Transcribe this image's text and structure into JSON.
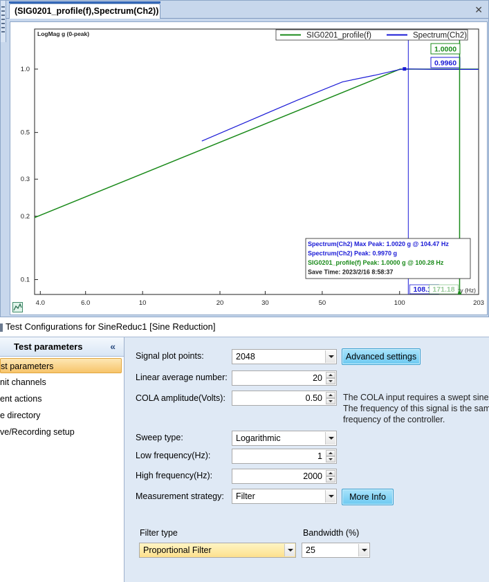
{
  "plot_window": {
    "tab_title": "(SIG0201_profile(f),Spectrum(Ch2))",
    "close_icon": "close-icon"
  },
  "chart_data": {
    "type": "line",
    "ylabel": "LogMag g (0-peak)",
    "xlabel": "Frequency (Hz)",
    "x_scale": "log",
    "y_scale": "log",
    "xlim": [
      3.8,
      203
    ],
    "ylim": [
      0.085,
      1.55
    ],
    "x_ticks": [
      4.0,
      6.0,
      10,
      20,
      30,
      50,
      100,
      203
    ],
    "x_tick_labels": [
      "4.0",
      "6.0",
      "10",
      "20",
      "30",
      "50",
      "100",
      "203"
    ],
    "y_ticks": [
      0.1,
      0.2,
      0.3,
      0.5,
      1.0
    ],
    "y_tick_labels": [
      "0.1",
      "0.2",
      "0.3",
      "0.5",
      "1.0"
    ],
    "legend_placement": "top-right",
    "series": [
      {
        "name": "SIG0201_profile(f)",
        "color": "#1a8a1a",
        "x": [
          3.8,
          100.28,
          203
        ],
        "y": [
          0.197,
          1.0,
          1.0
        ]
      },
      {
        "name": "Spectrum(Ch2)",
        "color": "#1a1ad6",
        "x": [
          17,
          25,
          40,
          60,
          80,
          100,
          104.47,
          140,
          203
        ],
        "y": [
          0.455,
          0.557,
          0.712,
          0.87,
          0.935,
          0.995,
          1.002,
          0.997,
          0.997
        ]
      }
    ],
    "cursors": [
      {
        "color": "#1a1ad6",
        "x": 108.11,
        "label": "108.11",
        "readout": "0.9960"
      },
      {
        "color": "#1a8a1a",
        "x": 171.18,
        "label": "171.18",
        "readout": "1.0000"
      }
    ],
    "info_box": [
      {
        "text": "Spectrum(Ch2) Max Peak: 1.0020 g @ 104.47 Hz",
        "color": "#1a1ad6"
      },
      {
        "text": "Spectrum(Ch2) Peak: 0.9970 g",
        "color": "#1a1ad6"
      },
      {
        "text": "SIG0201_profile(f) Peak: 1.0000 g @ 100.28 Hz",
        "color": "#1a8a1a"
      },
      {
        "text": "Save Time: 2023/2/16 8:58:37",
        "color": "#222222"
      }
    ]
  },
  "config": {
    "title": "Test Configurations for SineReduc1 [Sine Reduction]",
    "left_panel": {
      "header": "Test parameters",
      "collapse_icon": "«",
      "items": [
        "st parameters",
        "nit channels",
        "ent actions",
        "e directory",
        "ve/Recording setup"
      ]
    },
    "fields": {
      "signal_plot_points": {
        "label": "Signal plot points:",
        "value": "2048"
      },
      "advanced_settings": "Advanced settings",
      "linear_average": {
        "label": "Linear average number:",
        "value": "20"
      },
      "cola_amplitude": {
        "label": "COLA amplitude(Volts):",
        "value": "0.50"
      },
      "cola_note": [
        "The COLA input requires a swept sine sig",
        "The frequency of this signal is the same a",
        "frequency of the controller."
      ],
      "sweep_type": {
        "label": "Sweep type:",
        "value": "Logarithmic"
      },
      "low_freq": {
        "label": "Low frequency(Hz):",
        "value": "1"
      },
      "high_freq": {
        "label": "High frequency(Hz):",
        "value": "2000"
      },
      "measurement_strategy": {
        "label": "Measurement strategy:",
        "value": "Filter"
      },
      "more_info": "More Info",
      "filter_type": {
        "label": "Filter type",
        "value": "Proportional Filter"
      },
      "bandwidth": {
        "label": "Bandwidth (%)",
        "value": "25"
      }
    }
  }
}
